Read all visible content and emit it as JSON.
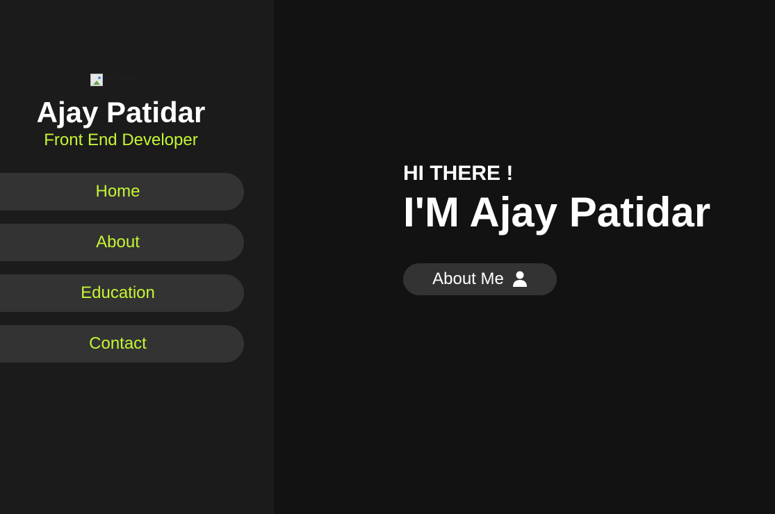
{
  "sidebar": {
    "profile_image_alt": "Ajay Patidar",
    "name": "Ajay Patidar",
    "role": "Front End Developer",
    "nav_items": [
      {
        "label": "Home"
      },
      {
        "label": "About"
      },
      {
        "label": "Education"
      },
      {
        "label": "Contact"
      }
    ]
  },
  "hero": {
    "greeting": "HI THERE !",
    "headline": "I'M Ajay Patidar",
    "about_button_label": "About Me",
    "about_button_icon": "user-icon"
  },
  "colors": {
    "accent": "#c5f535",
    "sidebar_bg": "#1b1b1b",
    "main_bg": "#121212",
    "pill_bg": "#333333",
    "text": "#ffffff"
  }
}
